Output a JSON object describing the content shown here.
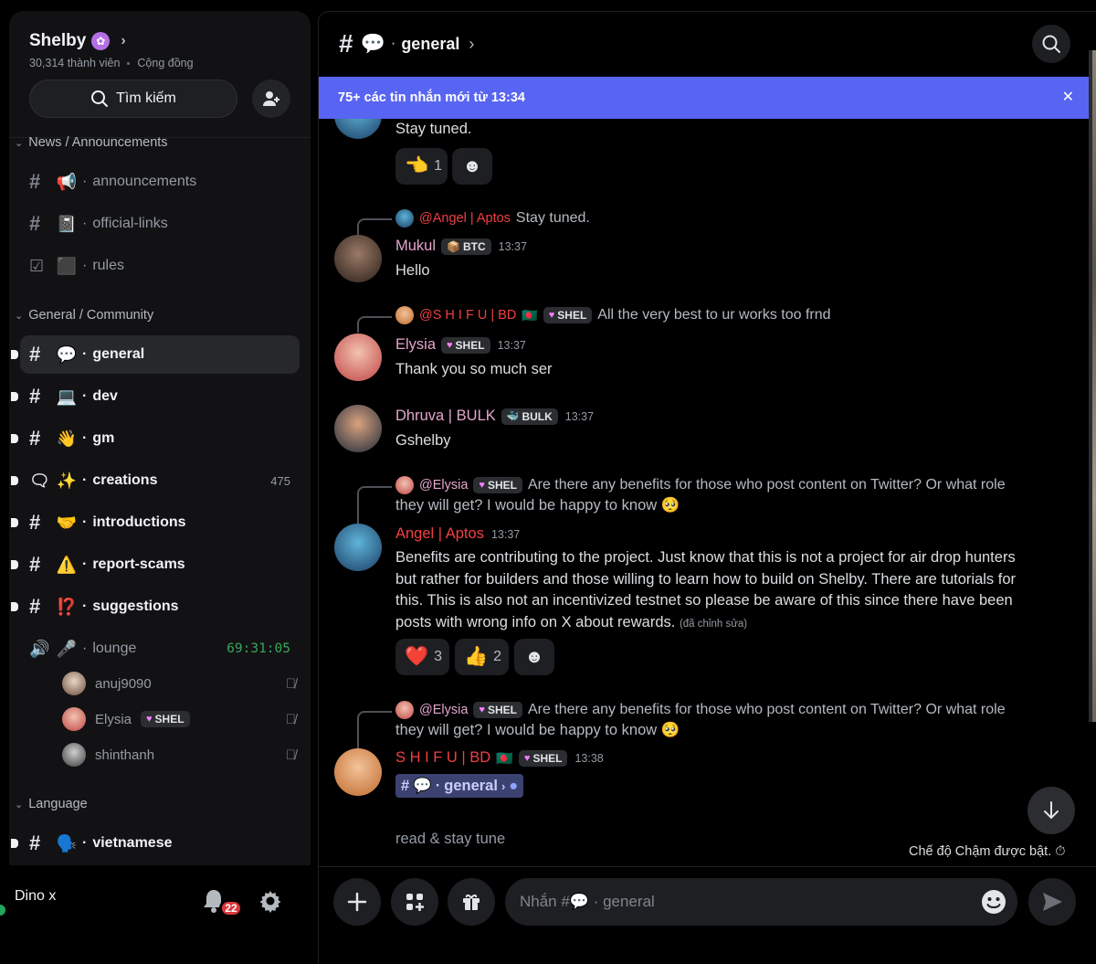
{
  "server": {
    "name": "Shelby",
    "members": "30,314 thành viên",
    "type": "Cộng đồng",
    "search_label": "Tìm kiếm"
  },
  "categories": {
    "news": "News / Announcements",
    "general": "General / Community",
    "language": "Language"
  },
  "channels": {
    "announcements": "announcements",
    "official_links": "official-links",
    "rules": "rules",
    "general": "general",
    "dev": "dev",
    "gm": "gm",
    "creations": "creations",
    "creations_count": "475",
    "introductions": "introductions",
    "report_scams": "report-scams",
    "suggestions": "suggestions",
    "lounge": "lounge",
    "lounge_timer": "69:31:05",
    "vietnamese": "vietnamese"
  },
  "voice_users": [
    {
      "name": "anuj9090"
    },
    {
      "name": "Elysia",
      "tag": "SHEL"
    },
    {
      "name": "shinthanh"
    }
  ],
  "user_panel": {
    "username": "Dino x",
    "notifications": "22"
  },
  "header": {
    "channel": "general"
  },
  "new_messages_bar": "75+ các tin nhắn mới từ 13:34",
  "messages": {
    "m0_text": "Stay tuned.",
    "m0_react1_count": "1",
    "m1_reply_name": "@Angel | Aptos",
    "m1_reply_text": "Stay tuned.",
    "m1_author": "Mukul",
    "m1_tag": "BTC",
    "m1_time": "13:37",
    "m1_text": "Hello",
    "m2_reply_name": "@S H I F U | BD",
    "m2_reply_tag": "SHEL",
    "m2_reply_text": "All the very best to ur works too frnd",
    "m2_author": "Elysia",
    "m2_tag": "SHEL",
    "m2_time": "13:37",
    "m2_text": "Thank you so much ser",
    "m3_author": "Dhruva | BULK",
    "m3_tag": "BULK",
    "m3_time": "13:37",
    "m3_text": "Gshelby",
    "m4_reply_name": "@Elysia",
    "m4_reply_tag": "SHEL",
    "m4_reply_text_1": "Are there any benefits for those who post content on Twitter? Or what role",
    "m4_reply_text_2": "they will get? I would be happy to know",
    "m4_author": "Angel | Aptos",
    "m4_time": "13:37",
    "m4_line1": "Benefits are contributing to the project.  Just know that this is not a project for air drop hunters",
    "m4_line2": "but rather for builders and those willing to learn how to build on Shelby.  There are tutorials for",
    "m4_line3": "this.  This is also not an incentivized testnet so please be aware of this since there have been",
    "m4_line4": "posts with wrong info on X about rewards.",
    "m4_edited": "(đã chỉnh sửa)",
    "m4_react_heart": "3",
    "m4_react_thumbs": "2",
    "m5_reply_name": "@Elysia",
    "m5_reply_tag": "SHEL",
    "m5_reply_text_1": "Are there any benefits for those who post content on Twitter? Or what role",
    "m5_reply_text_2": "they will get? I would be happy to know",
    "m5_author": "S H I F U | BD",
    "m5_tag": "SHEL",
    "m5_time": "13:38",
    "m5_mention": "general",
    "m6_partial": "read & stay tune"
  },
  "slow_mode": "Chế độ Chậm được bật.",
  "composer_placeholder": "Nhắn #💬 · general",
  "colors": {
    "accent": "#5865f2",
    "author_pink": "#e3a6cc",
    "author_red": "#f23f43",
    "online": "#23a55a",
    "timer_green": "#3ba55c"
  }
}
